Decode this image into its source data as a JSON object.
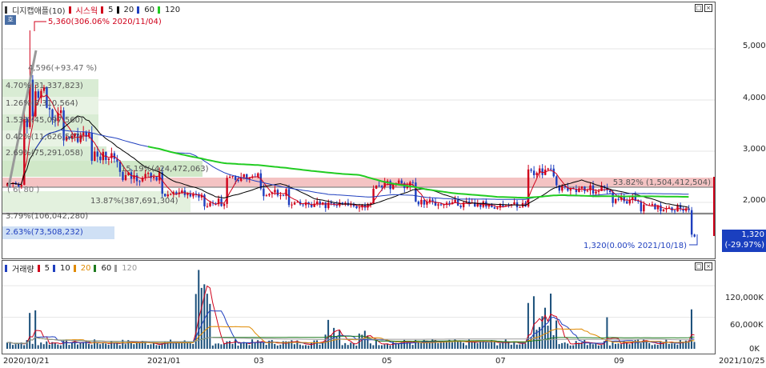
{
  "price_legend": {
    "title": "디지캡애플(10)",
    "items": [
      {
        "label": "시스웍",
        "color": "#d0021b"
      },
      {
        "label": "5",
        "color": "#d0021b"
      },
      {
        "label": "20",
        "color": "#000000"
      },
      {
        "label": "60",
        "color": "#1f3fbf"
      },
      {
        "label": "120",
        "color": "#22cc22"
      }
    ]
  },
  "volume_legend": {
    "title": "거래량",
    "items": [
      {
        "label": "5",
        "color": "#d0021b"
      },
      {
        "label": "10",
        "color": "#1f3fbf"
      },
      {
        "label": "20",
        "color": "#e08a00"
      },
      {
        "label": "60",
        "color": "#1e7a1e"
      },
      {
        "label": "120",
        "color": "#999999"
      }
    ]
  },
  "small_icon_label": "호",
  "annotations": {
    "high": "5,360(306.06% 2020/11/04)",
    "second_high": "4,596(+93.47 %)",
    "low": "1,320(0.00% 2021/10/18)",
    "band_right": "53.82% (1,504,412,504)",
    "levels": [
      "4.70%(31,337,823)",
      "1.26%(8,310,564)",
      "1.53%(45,097,560)",
      "0.42%(11,626,507)",
      "2.69%(75,291,058)",
      "15.19%(424,472,063)",
      "(  6(  80  )",
      "13.87%(387,691,304)",
      "3.79%(106,042,280)",
      "2.63%(73,508,232)"
    ]
  },
  "current_price": {
    "value": "1,320",
    "change": "(-29.97%)"
  },
  "y_axis_price": [
    "5,000",
    "4,000",
    "3,000",
    "2,000"
  ],
  "y_axis_volume": [
    "120,000K",
    "60,000K",
    "0K"
  ],
  "x_axis": [
    "2020/10/21",
    "2021/01",
    "03",
    "05",
    "07",
    "09",
    "2021/10/25"
  ],
  "chart_data": {
    "type": "candlestick",
    "x_start": "2020/10/21",
    "x_end": "2021/10/25",
    "price_ylim": [
      1000,
      5800
    ],
    "volume_ylim": [
      0,
      170000
    ],
    "price_high": 5360,
    "price_low": 1320,
    "last_price": 1320,
    "moving_averages": [
      "5",
      "20",
      "60",
      "120"
    ]
  }
}
